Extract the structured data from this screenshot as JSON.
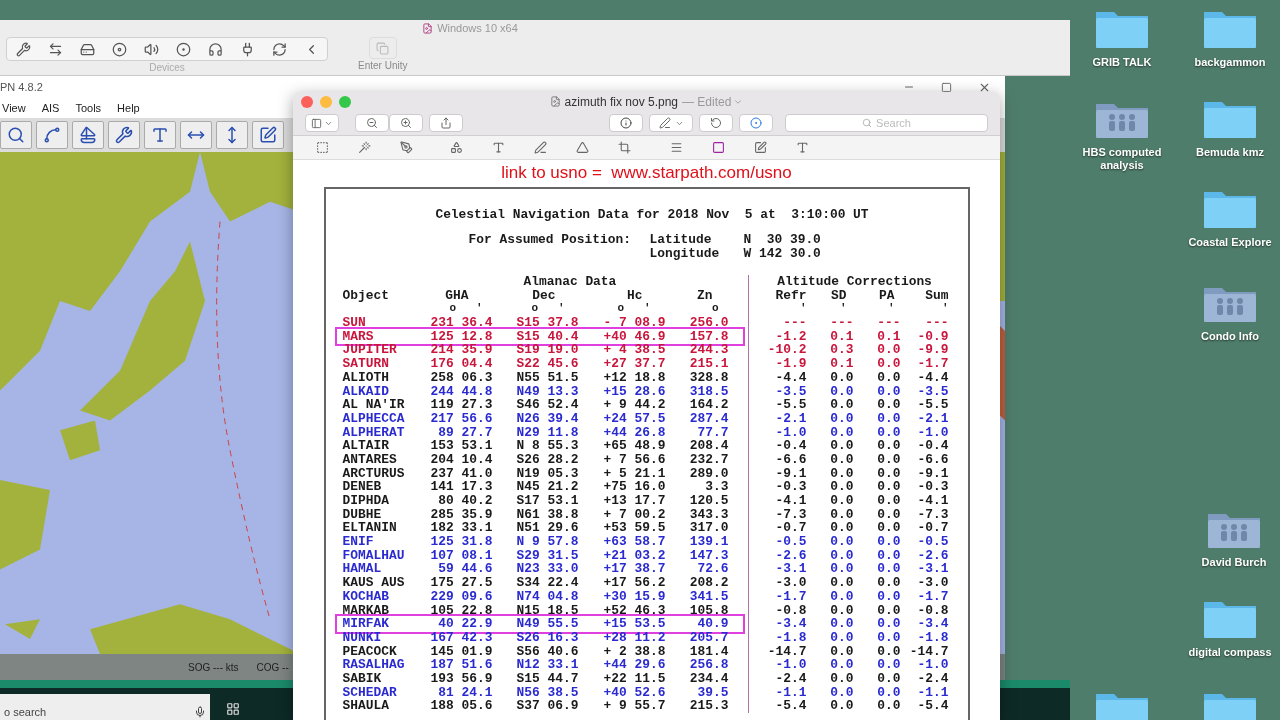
{
  "vm_window": {
    "title": "Windows 10 x64",
    "devices_label": "Devices",
    "unity_label": "Enter Unity"
  },
  "chart_app": {
    "title": "PN 4.8.2",
    "menu": [
      "View",
      "AIS",
      "Tools",
      "Help"
    ],
    "status": [
      "SOG --- kts",
      "COG --"
    ]
  },
  "taskbar": {
    "search_placeholder": "o search"
  },
  "preview": {
    "file_name": "azimuth fix nov 5.png",
    "edited": "— Edited",
    "search_placeholder": "Search",
    "caption": "link to usno =  www.starpath.com/usno",
    "heading": "Celestial Navigation Data for 2018 Nov  5 at  3:10:00 UT",
    "position_label": "For Assumed Position:",
    "latitude_label": "Latitude",
    "latitude": "N  30 39.0",
    "longitude_label": "Longitude",
    "longitude": "W 142 30.0",
    "groups": [
      "Almanac Data",
      "Altitude Corrections"
    ],
    "columns": [
      "Object",
      "GHA",
      "Dec",
      "Hc",
      "Zn",
      "Refr",
      "SD",
      "PA",
      "Sum"
    ],
    "units": [
      "o   '",
      "o   '",
      "o   '",
      "o",
      "'",
      "'",
      "'",
      "'"
    ],
    "rows": [
      {
        "object": "SUN",
        "gha": "231 36.4",
        "dec": "S15 37.8",
        "hc": "- 7 08.9",
        "zn": "256.0",
        "refr": "---",
        "sd": "---",
        "pa": "---",
        "sum": "---",
        "color": "#c8163c",
        "boxed": false
      },
      {
        "object": "MARS",
        "gha": "125 12.8",
        "dec": "S15 40.4",
        "hc": "+40 46.9",
        "zn": "157.8",
        "refr": "-1.2",
        "sd": "0.1",
        "pa": "0.1",
        "sum": "-0.9",
        "color": "#c8163c",
        "boxed": true
      },
      {
        "object": "JUPITER",
        "gha": "214 35.9",
        "dec": "S19 19.0",
        "hc": "+ 4 38.5",
        "zn": "244.3",
        "refr": "-10.2",
        "sd": "0.3",
        "pa": "0.0",
        "sum": "-9.9",
        "color": "#c8163c",
        "boxed": false
      },
      {
        "object": "SATURN",
        "gha": "176 04.4",
        "dec": "S22 45.6",
        "hc": "+27 37.7",
        "zn": "215.1",
        "refr": "-1.9",
        "sd": "0.1",
        "pa": "0.0",
        "sum": "-1.7",
        "color": "#c8163c",
        "boxed": false
      },
      {
        "object": "ALIOTH",
        "gha": "258 06.3",
        "dec": "N55 51.5",
        "hc": "+12 18.8",
        "zn": "328.8",
        "refr": "-4.4",
        "sd": "0.0",
        "pa": "0.0",
        "sum": "-4.4",
        "color": "#1a1a1a",
        "boxed": false
      },
      {
        "object": "ALKAID",
        "gha": "244 44.8",
        "dec": "N49 13.3",
        "hc": "+15 28.6",
        "zn": "318.5",
        "refr": "-3.5",
        "sd": "0.0",
        "pa": "0.0",
        "sum": "-3.5",
        "color": "#2a2ad0",
        "boxed": false
      },
      {
        "object": "AL NA'IR",
        "gha": "119 27.3",
        "dec": "S46 52.4",
        "hc": "+ 9 44.2",
        "zn": "164.2",
        "refr": "-5.5",
        "sd": "0.0",
        "pa": "0.0",
        "sum": "-5.5",
        "color": "#1a1a1a",
        "boxed": false
      },
      {
        "object": "ALPHECCA",
        "gha": "217 56.6",
        "dec": "N26 39.4",
        "hc": "+24 57.5",
        "zn": "287.4",
        "refr": "-2.1",
        "sd": "0.0",
        "pa": "0.0",
        "sum": "-2.1",
        "color": "#2a2ad0",
        "boxed": false
      },
      {
        "object": "ALPHERAT",
        "gha": "89 27.7",
        "dec": "N29 11.8",
        "hc": "+44 26.8",
        "zn": "77.7",
        "refr": "-1.0",
        "sd": "0.0",
        "pa": "0.0",
        "sum": "-1.0",
        "color": "#2a2ad0",
        "boxed": false
      },
      {
        "object": "ALTAIR",
        "gha": "153 53.1",
        "dec": "N 8 55.3",
        "hc": "+65 48.9",
        "zn": "208.4",
        "refr": "-0.4",
        "sd": "0.0",
        "pa": "0.0",
        "sum": "-0.4",
        "color": "#1a1a1a",
        "boxed": false
      },
      {
        "object": "ANTARES",
        "gha": "204 10.4",
        "dec": "S26 28.2",
        "hc": "+ 7 56.6",
        "zn": "232.7",
        "refr": "-6.6",
        "sd": "0.0",
        "pa": "0.0",
        "sum": "-6.6",
        "color": "#1a1a1a",
        "boxed": false
      },
      {
        "object": "ARCTURUS",
        "gha": "237 41.0",
        "dec": "N19 05.3",
        "hc": "+ 5 21.1",
        "zn": "289.0",
        "refr": "-9.1",
        "sd": "0.0",
        "pa": "0.0",
        "sum": "-9.1",
        "color": "#1a1a1a",
        "boxed": false
      },
      {
        "object": "DENEB",
        "gha": "141 17.3",
        "dec": "N45 21.2",
        "hc": "+75 16.0",
        "zn": "3.3",
        "refr": "-0.3",
        "sd": "0.0",
        "pa": "0.0",
        "sum": "-0.3",
        "color": "#1a1a1a",
        "boxed": false
      },
      {
        "object": "DIPHDA",
        "gha": "80 40.2",
        "dec": "S17 53.1",
        "hc": "+13 17.7",
        "zn": "120.5",
        "refr": "-4.1",
        "sd": "0.0",
        "pa": "0.0",
        "sum": "-4.1",
        "color": "#1a1a1a",
        "boxed": false
      },
      {
        "object": "DUBHE",
        "gha": "285 35.9",
        "dec": "N61 38.8",
        "hc": "+ 7 00.2",
        "zn": "343.3",
        "refr": "-7.3",
        "sd": "0.0",
        "pa": "0.0",
        "sum": "-7.3",
        "color": "#1a1a1a",
        "boxed": false
      },
      {
        "object": "ELTANIN",
        "gha": "182 33.1",
        "dec": "N51 29.6",
        "hc": "+53 59.5",
        "zn": "317.0",
        "refr": "-0.7",
        "sd": "0.0",
        "pa": "0.0",
        "sum": "-0.7",
        "color": "#1a1a1a",
        "boxed": false
      },
      {
        "object": "ENIF",
        "gha": "125 31.8",
        "dec": "N 9 57.8",
        "hc": "+63 58.7",
        "zn": "139.1",
        "refr": "-0.5",
        "sd": "0.0",
        "pa": "0.0",
        "sum": "-0.5",
        "color": "#2a2ad0",
        "boxed": false
      },
      {
        "object": "FOMALHAU",
        "gha": "107 08.1",
        "dec": "S29 31.5",
        "hc": "+21 03.2",
        "zn": "147.3",
        "refr": "-2.6",
        "sd": "0.0",
        "pa": "0.0",
        "sum": "-2.6",
        "color": "#2a2ad0",
        "boxed": false
      },
      {
        "object": "HAMAL",
        "gha": "59 44.6",
        "dec": "N23 33.0",
        "hc": "+17 38.7",
        "zn": "72.6",
        "refr": "-3.1",
        "sd": "0.0",
        "pa": "0.0",
        "sum": "-3.1",
        "color": "#2a2ad0",
        "boxed": false
      },
      {
        "object": "KAUS AUS",
        "gha": "175 27.5",
        "dec": "S34 22.4",
        "hc": "+17 56.2",
        "zn": "208.2",
        "refr": "-3.0",
        "sd": "0.0",
        "pa": "0.0",
        "sum": "-3.0",
        "color": "#1a1a1a",
        "boxed": false
      },
      {
        "object": "KOCHAB",
        "gha": "229 09.6",
        "dec": "N74 04.8",
        "hc": "+30 15.9",
        "zn": "341.5",
        "refr": "-1.7",
        "sd": "0.0",
        "pa": "0.0",
        "sum": "-1.7",
        "color": "#2a2ad0",
        "boxed": false
      },
      {
        "object": "MARKAB",
        "gha": "105 22.8",
        "dec": "N15 18.5",
        "hc": "+52 46.3",
        "zn": "105.8",
        "refr": "-0.8",
        "sd": "0.0",
        "pa": "0.0",
        "sum": "-0.8",
        "color": "#1a1a1a",
        "boxed": false
      },
      {
        "object": "MIRFAK",
        "gha": "40 22.9",
        "dec": "N49 55.5",
        "hc": "+15 53.5",
        "zn": "40.9",
        "refr": "-3.4",
        "sd": "0.0",
        "pa": "0.0",
        "sum": "-3.4",
        "color": "#2a2ad0",
        "boxed": true
      },
      {
        "object": "NUNKI",
        "gha": "167 42.3",
        "dec": "S26 16.3",
        "hc": "+28 11.2",
        "zn": "205.7",
        "refr": "-1.8",
        "sd": "0.0",
        "pa": "0.0",
        "sum": "-1.8",
        "color": "#2a2ad0",
        "boxed": false
      },
      {
        "object": "PEACOCK",
        "gha": "145 01.9",
        "dec": "S56 40.6",
        "hc": "+ 2 38.8",
        "zn": "181.4",
        "refr": "-14.7",
        "sd": "0.0",
        "pa": "0.0",
        "sum": "-14.7",
        "color": "#1a1a1a",
        "boxed": false
      },
      {
        "object": "RASALHAG",
        "gha": "187 51.6",
        "dec": "N12 33.1",
        "hc": "+44 29.6",
        "zn": "256.8",
        "refr": "-1.0",
        "sd": "0.0",
        "pa": "0.0",
        "sum": "-1.0",
        "color": "#2a2ad0",
        "boxed": false
      },
      {
        "object": "SABIK",
        "gha": "193 56.9",
        "dec": "S15 44.7",
        "hc": "+22 11.5",
        "zn": "234.4",
        "refr": "-2.4",
        "sd": "0.0",
        "pa": "0.0",
        "sum": "-2.4",
        "color": "#1a1a1a",
        "boxed": false
      },
      {
        "object": "SCHEDAR",
        "gha": "81 24.1",
        "dec": "N56 38.5",
        "hc": "+40 52.6",
        "zn": "39.5",
        "refr": "-1.1",
        "sd": "0.0",
        "pa": "0.0",
        "sum": "-1.1",
        "color": "#2a2ad0",
        "boxed": false
      },
      {
        "object": "SHAULA",
        "gha": "188 05.6",
        "dec": "S37 06.9",
        "hc": "+ 9 55.7",
        "zn": "215.3",
        "refr": "-5.4",
        "sd": "0.0",
        "pa": "0.0",
        "sum": "-5.4",
        "color": "#1a1a1a",
        "boxed": false
      }
    ]
  },
  "desktop": {
    "icons": [
      {
        "label": "GRIB TALK",
        "kind": "folder"
      },
      {
        "label": "backgammon",
        "kind": "folder"
      },
      {
        "label": "HBS computed analysis",
        "kind": "shared"
      },
      {
        "label": "Bemuda kmz",
        "kind": "folder"
      },
      {
        "label": "Coastal Explore",
        "kind": "folder"
      },
      {
        "label": "Condo Info",
        "kind": "shared"
      },
      {
        "label": "David Burch",
        "kind": "shared"
      },
      {
        "label": "digital compass",
        "kind": "folder"
      },
      {
        "kind": "folder"
      },
      {
        "kind": "folder"
      }
    ]
  }
}
